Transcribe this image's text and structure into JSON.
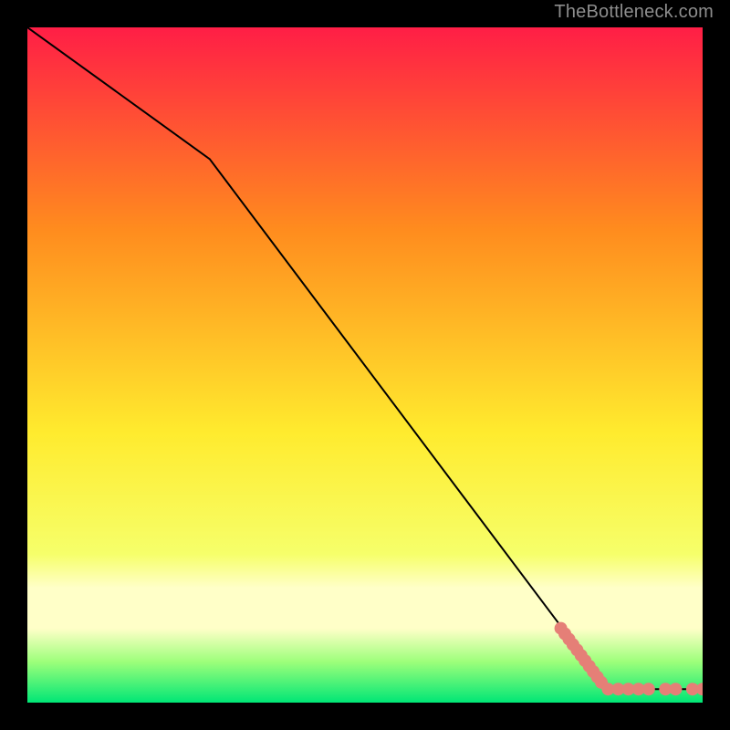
{
  "attribution": "TheBottleneck.com",
  "colors": {
    "frame": "#000000",
    "curve": "#000000",
    "marker": "#E57F77",
    "grad_top": "#FF1E46",
    "grad_mid1": "#FF8C1E",
    "grad_mid2": "#FFEB2E",
    "grad_mid3": "#F6FF6A",
    "grad_band": "#FFFFC8",
    "grad_green1": "#9CFF7A",
    "grad_green2": "#00E676"
  },
  "chart_data": {
    "type": "line",
    "title": "",
    "xlabel": "",
    "ylabel": "",
    "xlim": [
      0,
      100
    ],
    "ylim": [
      0,
      100
    ],
    "curve": [
      {
        "x": 0,
        "y": 100
      },
      {
        "x": 27,
        "y": 80.5
      },
      {
        "x": 86,
        "y": 2
      },
      {
        "x": 100,
        "y": 2
      }
    ],
    "series": [
      {
        "name": "markers",
        "points": [
          {
            "x": 79.0,
            "y": 11.0
          },
          {
            "x": 79.6,
            "y": 10.2
          },
          {
            "x": 80.2,
            "y": 9.4
          },
          {
            "x": 80.8,
            "y": 8.6
          },
          {
            "x": 81.4,
            "y": 7.8
          },
          {
            "x": 82.0,
            "y": 7.0
          },
          {
            "x": 82.6,
            "y": 6.2
          },
          {
            "x": 83.2,
            "y": 5.4
          },
          {
            "x": 83.8,
            "y": 4.6
          },
          {
            "x": 84.4,
            "y": 3.8
          },
          {
            "x": 85.0,
            "y": 3.0
          },
          {
            "x": 86.0,
            "y": 2.0
          },
          {
            "x": 87.5,
            "y": 2.0
          },
          {
            "x": 89.0,
            "y": 2.0
          },
          {
            "x": 90.5,
            "y": 2.0
          },
          {
            "x": 92.0,
            "y": 2.0
          },
          {
            "x": 94.5,
            "y": 2.0
          },
          {
            "x": 96.0,
            "y": 2.0
          },
          {
            "x": 98.5,
            "y": 2.0
          },
          {
            "x": 100.0,
            "y": 2.0
          }
        ]
      }
    ]
  }
}
